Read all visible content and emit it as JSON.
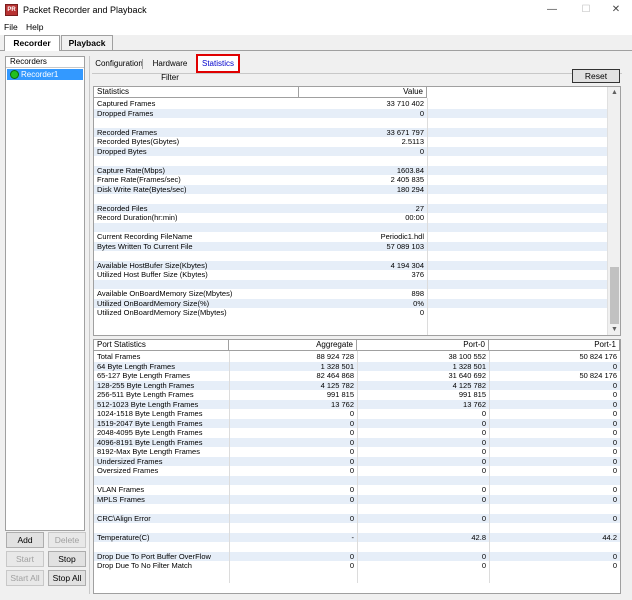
{
  "window": {
    "title": "Packet Recorder and Playback",
    "minimize": "—",
    "maximize": "☐",
    "close": "✕"
  },
  "menu": {
    "file": "File",
    "help": "Help"
  },
  "main_tabs": {
    "recorder": "Recorder",
    "playback": "Playback"
  },
  "recorders": {
    "header": "Recorders",
    "items": [
      "Recorder1"
    ],
    "status_color": "#22c022"
  },
  "left_buttons": {
    "add": "Add",
    "delete": "Delete",
    "start": "Start",
    "stop": "Stop",
    "start_all": "Start All",
    "stop_all": "Stop All"
  },
  "sub_tabs": {
    "configuration": "Configuration",
    "hardware_filter": "Hardware Filter",
    "statistics": "Statistics"
  },
  "reset_label": "Reset",
  "stats": {
    "headers": [
      "Statistics",
      "Value"
    ],
    "rows": [
      {
        "name": "Captured Frames",
        "value": "33 710 402"
      },
      {
        "name": "Dropped Frames",
        "value": "0"
      },
      {
        "name": "",
        "value": ""
      },
      {
        "name": "Recorded Frames",
        "value": "33 671 797"
      },
      {
        "name": "Recorded Bytes(Gbytes)",
        "value": "2.5113"
      },
      {
        "name": "Dropped Bytes",
        "value": "0"
      },
      {
        "name": "",
        "value": ""
      },
      {
        "name": "Capture Rate(Mbps)",
        "value": "1603.84"
      },
      {
        "name": "Frame Rate(Frames/sec)",
        "value": "2 405 835"
      },
      {
        "name": "Disk Write Rate(Bytes/sec)",
        "value": "180 294"
      },
      {
        "name": "",
        "value": ""
      },
      {
        "name": "Recorded Files",
        "value": "27"
      },
      {
        "name": "Record Duration(hr:min)",
        "value": "00:00"
      },
      {
        "name": "",
        "value": ""
      },
      {
        "name": "Current Recording FileName",
        "value": "Periodic1.hdl"
      },
      {
        "name": "Bytes Written To Current File",
        "value": "57 089 103"
      },
      {
        "name": "",
        "value": ""
      },
      {
        "name": "Available HostBufer Size(Kbytes)",
        "value": "4 194 304"
      },
      {
        "name": "Utilized Host Buffer Size (Kbytes)",
        "value": "376"
      },
      {
        "name": "",
        "value": ""
      },
      {
        "name": "Available OnBoardMemory Size(Mbytes)",
        "value": "898"
      },
      {
        "name": "Utilized OnBoardMemory Size(%)",
        "value": "0%"
      },
      {
        "name": "Utilized OnBoardMemory Size(Mbytes)",
        "value": "0"
      }
    ]
  },
  "ports": {
    "headers": [
      "Port Statistics",
      "Aggregate",
      "Port-0",
      "Port-1"
    ],
    "rows": [
      {
        "name": "Total Frames",
        "agg": "88 924 728",
        "p0": "38 100 552",
        "p1": "50 824 176"
      },
      {
        "name": "64 Byte Length Frames",
        "agg": "1 328 501",
        "p0": "1 328 501",
        "p1": "0"
      },
      {
        "name": "65-127 Byte Length Frames",
        "agg": "82 464 868",
        "p0": "31 640 692",
        "p1": "50 824 176"
      },
      {
        "name": "128-255 Byte Length Frames",
        "agg": "4 125 782",
        "p0": "4 125 782",
        "p1": "0"
      },
      {
        "name": "256-511 Byte Length Frames",
        "agg": "991 815",
        "p0": "991 815",
        "p1": "0"
      },
      {
        "name": "512-1023 Byte Length Frames",
        "agg": "13 762",
        "p0": "13 762",
        "p1": "0"
      },
      {
        "name": "1024-1518 Byte Length Frames",
        "agg": "0",
        "p0": "0",
        "p1": "0"
      },
      {
        "name": "1519-2047 Byte Length Frames",
        "agg": "0",
        "p0": "0",
        "p1": "0"
      },
      {
        "name": "2048-4095 Byte Length Frames",
        "agg": "0",
        "p0": "0",
        "p1": "0"
      },
      {
        "name": "4096-8191 Byte Length Frames",
        "agg": "0",
        "p0": "0",
        "p1": "0"
      },
      {
        "name": "8192-Max Byte Length Frames",
        "agg": "0",
        "p0": "0",
        "p1": "0"
      },
      {
        "name": "Undersized Frames",
        "agg": "0",
        "p0": "0",
        "p1": "0"
      },
      {
        "name": "Oversized Frames",
        "agg": "0",
        "p0": "0",
        "p1": "0"
      },
      {
        "name": "",
        "agg": "",
        "p0": "",
        "p1": ""
      },
      {
        "name": "VLAN Frames",
        "agg": "0",
        "p0": "0",
        "p1": "0"
      },
      {
        "name": "MPLS Frames",
        "agg": "0",
        "p0": "0",
        "p1": "0"
      },
      {
        "name": "",
        "agg": "",
        "p0": "",
        "p1": ""
      },
      {
        "name": "CRC\\Align Error",
        "agg": "0",
        "p0": "0",
        "p1": "0"
      },
      {
        "name": "",
        "agg": "",
        "p0": "",
        "p1": ""
      },
      {
        "name": "Temperature(C)",
        "agg": "-",
        "p0": "42.8",
        "p1": "44.2"
      },
      {
        "name": "",
        "agg": "",
        "p0": "",
        "p1": ""
      },
      {
        "name": "Drop Due To Port Buffer OverFlow",
        "agg": "0",
        "p0": "0",
        "p1": "0"
      },
      {
        "name": "Drop Due To No Filter Match",
        "agg": "0",
        "p0": "0",
        "p1": "0"
      }
    ]
  },
  "colors": {
    "row_alt": "#e6eef8",
    "selection": "#3399ff",
    "highlight_border": "#e00000"
  }
}
